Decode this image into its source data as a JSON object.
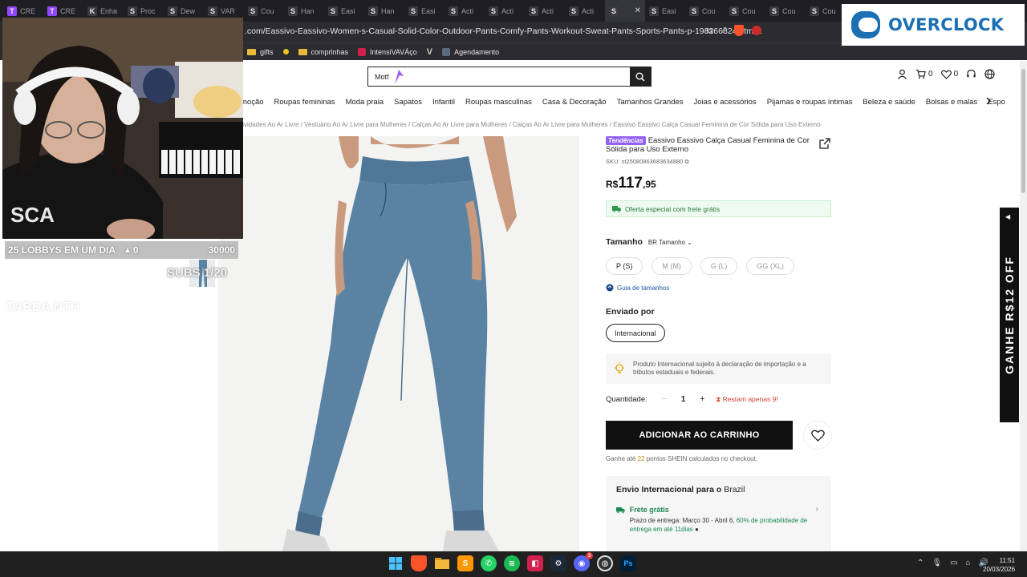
{
  "browser": {
    "tabs": [
      {
        "label": "CRE",
        "icon": "T",
        "icon_color": "#9146ff"
      },
      {
        "label": "CRE",
        "icon": "T",
        "icon_color": "#9146ff"
      },
      {
        "label": "Enha",
        "icon": "K",
        "icon_color": "#3a3a40"
      },
      {
        "label": "Proc",
        "icon": "S",
        "icon_color": "#3a3a40"
      },
      {
        "label": "Dew",
        "icon": "S",
        "icon_color": "#3a3a40"
      },
      {
        "label": "VAR",
        "icon": "S",
        "icon_color": "#3a3a40"
      },
      {
        "label": "Cou",
        "icon": "S",
        "icon_color": "#3a3a40"
      },
      {
        "label": "Han",
        "icon": "S",
        "icon_color": "#3a3a40"
      },
      {
        "label": "Easi",
        "icon": "S",
        "icon_color": "#3a3a40"
      },
      {
        "label": "Han",
        "icon": "S",
        "icon_color": "#3a3a40"
      },
      {
        "label": "Easi",
        "icon": "S",
        "icon_color": "#3a3a40"
      },
      {
        "label": "Acti",
        "icon": "S",
        "icon_color": "#3a3a40"
      },
      {
        "label": "Acti",
        "icon": "S",
        "icon_color": "#3a3a40"
      },
      {
        "label": "Acti",
        "icon": "S",
        "icon_color": "#3a3a40"
      },
      {
        "label": "Acti",
        "icon": "S",
        "icon_color": "#3a3a40"
      },
      {
        "label": "",
        "icon": "S",
        "icon_color": "#3a3a40",
        "active": true
      },
      {
        "label": "Easi",
        "icon": "S",
        "icon_color": "#3a3a40"
      },
      {
        "label": "Cou",
        "icon": "S",
        "icon_color": "#3a3a40"
      },
      {
        "label": "Cou",
        "icon": "S",
        "icon_color": "#3a3a40"
      },
      {
        "label": "Cou",
        "icon": "S",
        "icon_color": "#3a3a40"
      },
      {
        "label": "Cou",
        "icon": "S",
        "icon_color": "#3a3a40"
      }
    ],
    "url": ".com/Eassivo-Eassivo-Women-s-Casual-Solid-Color-Outdoor-Pants-Comfy-Pants-Workout-Sweat-Pants-Sports-Pants-p-198266824.html...",
    "bookmarks": [
      {
        "label": "gifts",
        "type": "folder"
      },
      {
        "label": "",
        "type": "dot"
      },
      {
        "label": "comprinhas",
        "type": "folder"
      },
      {
        "label": "IntensiVAVÁço",
        "type": "app"
      },
      {
        "label": "Agendamento",
        "type": "cal"
      }
    ]
  },
  "overlay": {
    "stream_title": "25 LOBBYS EM UM DIA",
    "stream_count": "0",
    "stream_goal": "30000",
    "subs": "SUBS 1/20",
    "ghost": "TARDA NTH",
    "logo": "OVERCLOCK"
  },
  "shop": {
    "search_value": "Motf",
    "cart_count": "0",
    "wish_count": "0",
    "nav": [
      "moção",
      "Roupas femininas",
      "Moda praia",
      "Sapatos",
      "Infantil",
      "Roupas masculinas",
      "Casa & Decoração",
      "Tamanhos Grandes",
      "Joias e acessórios",
      "Pijamas e roupas íntimas",
      "Beleza e saúde",
      "Bolsas e malas",
      "Espo"
    ],
    "breadcrumb": "tividades Ao Ar Livre / Vestuário Ao Ar Livre para Mulheres / Calças Ao Ar Livre para Mulheres / Calças Ao Ar Livre para Mulheres / Eassivo Eassivo Calça Casual Feminina de Cor Sólida para Uso Externo",
    "badge": "Tendências",
    "title": "Eassivo Eassivo Calça Casual Feminina de Cor Sólida para Uso Externo",
    "sku": "SKU: st25080863683634880",
    "price_currency": "R$",
    "price_int": "117",
    "price_dec": ",95",
    "freeship": "Oferta especial com frete grátis",
    "size_label": "Tamanho",
    "size_system": "BR Tamanho",
    "sizes": [
      "P (S)",
      "M (M)",
      "G (L)",
      "GG (XL)"
    ],
    "size_guide": "Guia de tamanhos",
    "sent_by": "Enviado por",
    "ship_option": "Internacional",
    "notice": "Produto Internacional sujeito à declaração de importação e a tributos estaduais e federais.",
    "qty_label": "Quantidade:",
    "qty_value": "1",
    "qty_remain": "Restam apenas 9!",
    "addcart": "ADICIONAR AO CARRINHO",
    "points_pre": "Ganhe até",
    "points_num": "22",
    "points_post": "pontos SHEIN calculados no checkout.",
    "intl_title": "Envio Internacional para o",
    "intl_country": "Brazil",
    "free_label": "Frete grátis",
    "eta_line1": "Prazo de entrega: Março 30 - Abril 6,",
    "eta_pct": "60% de probabilidade de entrega em até",
    "eta_days": "11dias",
    "promo_side": "GANHE R$12 OFF"
  },
  "taskbar": {
    "time": "11:51",
    "date": "20/03/2026",
    "discord_badge": "3"
  }
}
